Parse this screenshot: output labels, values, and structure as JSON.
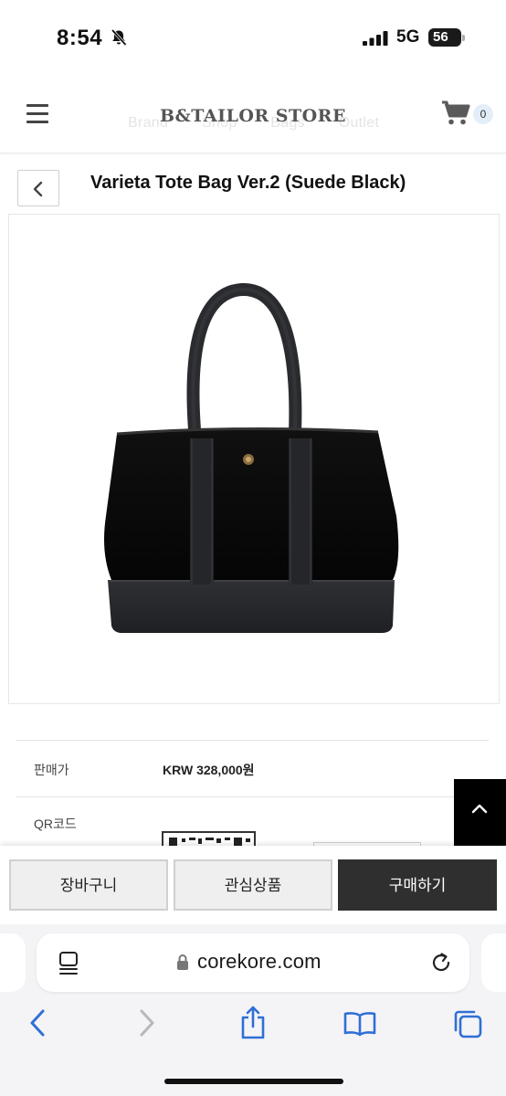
{
  "status_bar": {
    "time": "8:54",
    "network": "5G",
    "battery_level": "56"
  },
  "header": {
    "logo": "B&TAILOR STORE",
    "ghost_nav": [
      "Brand",
      "Shop",
      "Bags",
      "Outlet"
    ],
    "cart_count": "0"
  },
  "product": {
    "title": "Varieta Tote Bag Ver.2 (Suede Black)",
    "price_label": "판매가",
    "price_value": "KRW 328,000원",
    "qr_label": "QR코드"
  },
  "actions": {
    "cart_label": "장바구니",
    "wishlist_label": "관심상품",
    "buy_label": "구매하기"
  },
  "browser": {
    "url": "corekore.com"
  },
  "colors": {
    "buy_button_bg": "#2f2f2f",
    "secondary_button_bg": "#efefef",
    "browser_tint": "#2f6fd6"
  }
}
